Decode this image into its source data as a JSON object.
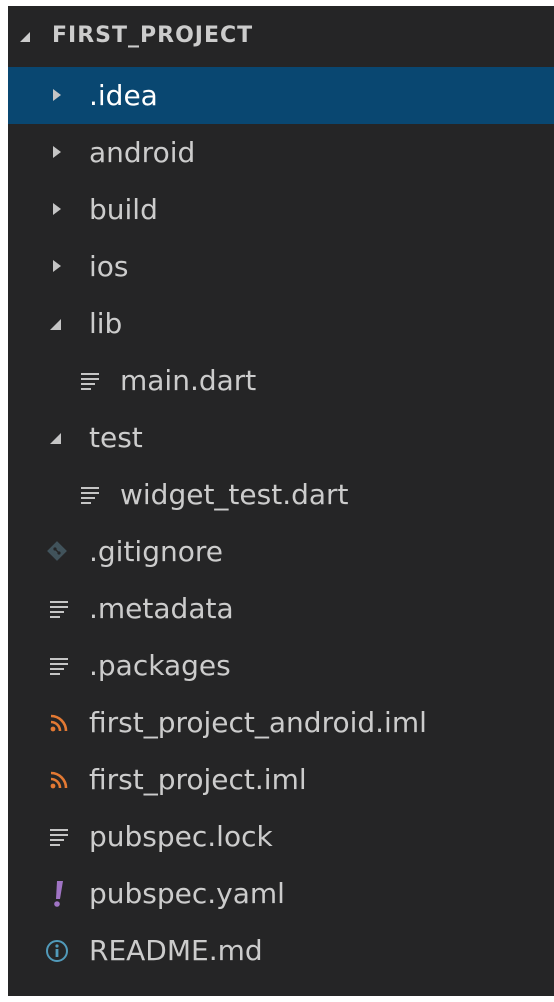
{
  "explorer": {
    "project_title": "FIRST_PROJECT",
    "items": [
      {
        "label": ".idea",
        "icon": "chevron-right-icon",
        "kind": "folder",
        "expanded": false,
        "selected": true,
        "depth": 0
      },
      {
        "label": "android",
        "icon": "chevron-right-icon",
        "kind": "folder",
        "expanded": false,
        "selected": false,
        "depth": 0
      },
      {
        "label": "build",
        "icon": "chevron-right-icon",
        "kind": "folder",
        "expanded": false,
        "selected": false,
        "depth": 0
      },
      {
        "label": "ios",
        "icon": "chevron-right-icon",
        "kind": "folder",
        "expanded": false,
        "selected": false,
        "depth": 0
      },
      {
        "label": "lib",
        "icon": "chevron-down-icon",
        "kind": "folder",
        "expanded": true,
        "selected": false,
        "depth": 0
      },
      {
        "label": "main.dart",
        "icon": "text-file-icon",
        "kind": "file",
        "selected": false,
        "depth": 1
      },
      {
        "label": "test",
        "icon": "chevron-down-icon",
        "kind": "folder",
        "expanded": true,
        "selected": false,
        "depth": 0
      },
      {
        "label": "widget_test.dart",
        "icon": "text-file-icon",
        "kind": "file",
        "selected": false,
        "depth": 1
      },
      {
        "label": ".gitignore",
        "icon": "git-icon",
        "kind": "file",
        "selected": false,
        "depth": 0
      },
      {
        "label": ".metadata",
        "icon": "text-file-icon",
        "kind": "file",
        "selected": false,
        "depth": 0
      },
      {
        "label": ".packages",
        "icon": "text-file-icon",
        "kind": "file",
        "selected": false,
        "depth": 0
      },
      {
        "label": "first_project_android.iml",
        "icon": "rss-icon",
        "kind": "file",
        "selected": false,
        "depth": 0
      },
      {
        "label": "first_project.iml",
        "icon": "rss-icon",
        "kind": "file",
        "selected": false,
        "depth": 0
      },
      {
        "label": "pubspec.lock",
        "icon": "text-file-icon",
        "kind": "file",
        "selected": false,
        "depth": 0
      },
      {
        "label": "pubspec.yaml",
        "icon": "exclamation-icon",
        "kind": "file",
        "selected": false,
        "depth": 0
      },
      {
        "label": "README.md",
        "icon": "info-icon",
        "kind": "file",
        "selected": false,
        "depth": 0
      }
    ]
  },
  "colors": {
    "panel_bg": "#252526",
    "selection_bg": "#094771",
    "text": "#cccccc",
    "icon_gray": "#c5c5c5",
    "git_icon": "#41535b",
    "rss_orange": "#e37933",
    "yaml_purple": "#a074c4",
    "info_blue": "#519aba"
  }
}
